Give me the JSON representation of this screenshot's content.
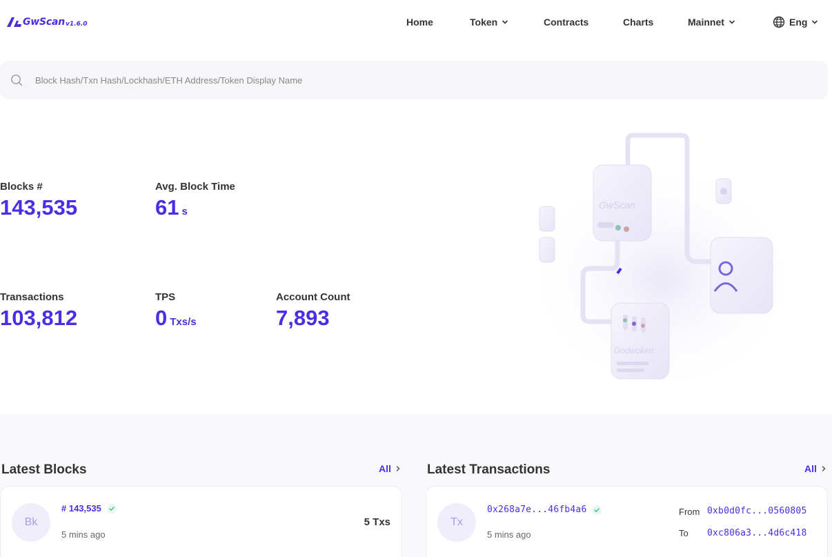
{
  "header": {
    "logo": {
      "name": "GwScan",
      "version": "v1.6.0"
    },
    "nav": {
      "home": "Home",
      "token": "Token",
      "contracts": "Contracts",
      "charts": "Charts",
      "network": "Mainnet",
      "language": "Eng"
    }
  },
  "search": {
    "placeholder": "Block Hash/Txn Hash/Lockhash/ETH Address/Token Display Name"
  },
  "stats": {
    "blocks": {
      "label": "Blocks #",
      "value": "143,535"
    },
    "avg_block_time": {
      "label": "Avg. Block Time",
      "value": "61",
      "unit": "s"
    },
    "transactions": {
      "label": "Transactions",
      "value": "103,812"
    },
    "tps": {
      "label": "TPS",
      "value": "0",
      "unit": "Txs/s"
    },
    "account_count": {
      "label": "Account Count",
      "value": "7,893"
    }
  },
  "illustration": {
    "top_card_label": "GwScan",
    "bottom_card_label": "Godwoken"
  },
  "latest_blocks": {
    "title": "Latest Blocks",
    "all_label": "All",
    "items": [
      {
        "avatar": "Bk",
        "number": "# 143,535",
        "time": "5 mins ago",
        "txs": "5 Txs"
      }
    ]
  },
  "latest_transactions": {
    "title": "Latest Transactions",
    "all_label": "All",
    "items": [
      {
        "avatar": "Tx",
        "hash": "0x268a7e...46fb4a6",
        "time": "5 mins ago",
        "from_label": "From",
        "from": "0xb0d0fc...0560805",
        "to_label": "To",
        "to": "0xc806a3...4d6c418"
      }
    ]
  },
  "colors": {
    "accent": "#4c2ce4",
    "success": "#3cc68a",
    "text": "#333333",
    "muted": "#666666"
  }
}
